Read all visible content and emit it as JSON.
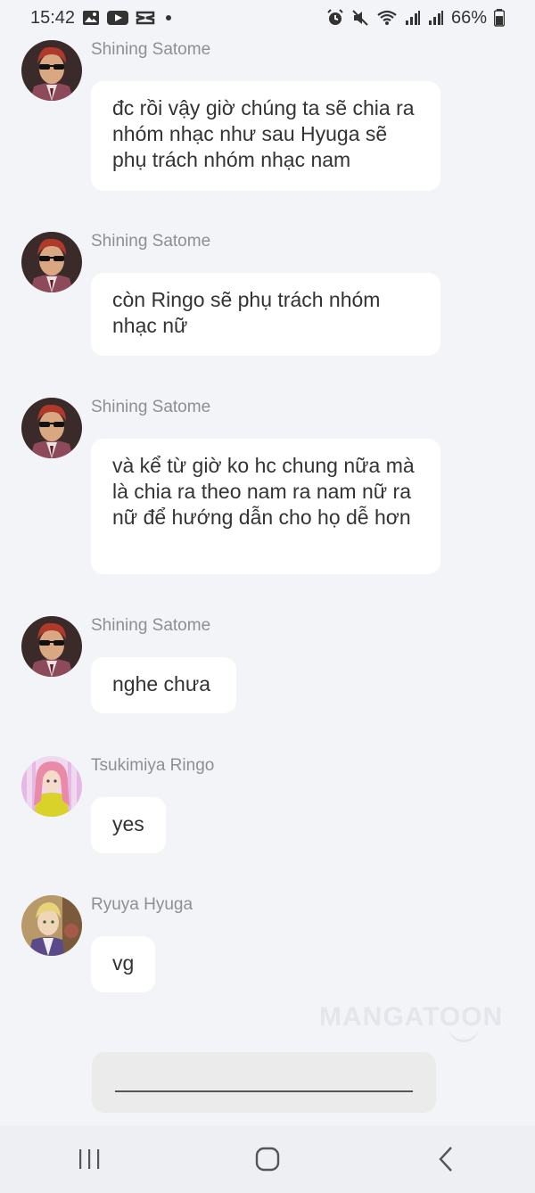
{
  "status_bar": {
    "time": "15:42",
    "battery": "66%"
  },
  "messages": [
    {
      "sender": "Shining Satome",
      "text": "đc rồi vậy giờ chúng ta sẽ chia ra nhóm nhạc như sau Hyuga sẽ phụ trách nhóm nhạc nam",
      "avatar": "satome-avatar"
    },
    {
      "sender": "Shining Satome",
      "text": "còn Ringo sẽ phụ trách nhóm nhạc nữ",
      "avatar": "satome-avatar"
    },
    {
      "sender": "Shining Satome",
      "text": "và kể từ giờ ko hc chung nữa mà là chia ra theo nam ra nam nữ ra nữ để hướng dẫn cho họ dễ hơn",
      "avatar": "satome-avatar"
    },
    {
      "sender": "Shining Satome",
      "text": "nghe chưa",
      "avatar": "satome-avatar"
    },
    {
      "sender": "Tsukimiya Ringo",
      "text": "yes",
      "avatar": "ringo-avatar"
    },
    {
      "sender": "Ryuya Hyuga",
      "text": "vg",
      "avatar": "hyuga-avatar"
    }
  ],
  "watermark": "MANGATOON",
  "input": {
    "placeholder": "",
    "value": ""
  },
  "colors": {
    "background": "#f3f4f8",
    "bubble": "#ffffff",
    "sender": "#8e8e93"
  }
}
